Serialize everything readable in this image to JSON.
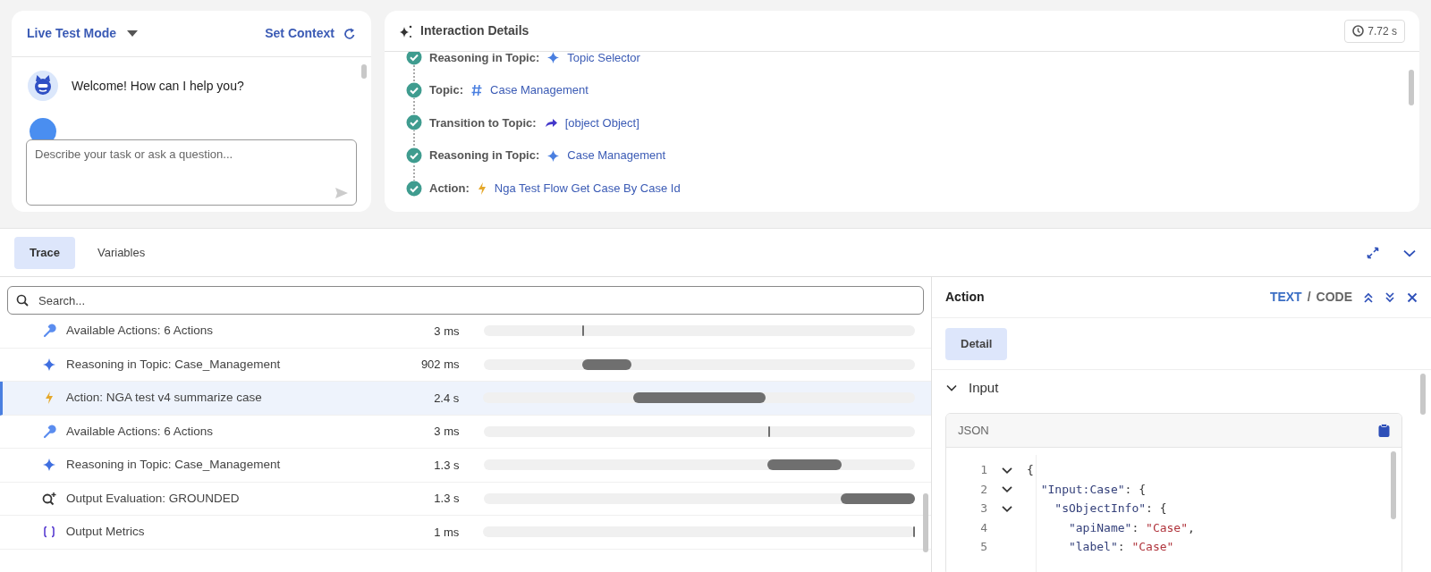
{
  "chat": {
    "mode": "Live Test Mode",
    "set_context": "Set Context",
    "messages": [
      {
        "text": "Welcome! How can I help you?"
      }
    ],
    "input": {
      "placeholder": "Describe your task or ask a question..."
    }
  },
  "interaction": {
    "title": "Interaction Details",
    "duration": "7.72 s",
    "steps": [
      {
        "kind": "reasoning",
        "label": "Reasoning in Topic:",
        "value": "Topic Selector"
      },
      {
        "kind": "topic",
        "label": "Topic:",
        "value": "Case Management"
      },
      {
        "kind": "transition",
        "label": "Transition to Topic:",
        "value": "[object Object]"
      },
      {
        "kind": "reasoning",
        "label": "Reasoning in Topic:",
        "value": "Case Management"
      },
      {
        "kind": "action",
        "label": "Action:",
        "value": "Nga Test Flow Get Case By Case Id"
      }
    ]
  },
  "tabs": [
    {
      "label": "Trace",
      "selected": true
    },
    {
      "label": "Variables",
      "selected": false
    }
  ],
  "trace": {
    "search": {
      "placeholder": "Search..."
    },
    "rows": [
      {
        "kind": "actions",
        "label": "Available Actions: 6 Actions",
        "duration": "3 ms",
        "selected": false
      },
      {
        "kind": "reasoning",
        "label": "Reasoning in Topic: Case_Management",
        "duration": "902 ms",
        "selected": false
      },
      {
        "kind": "action",
        "label": "Action: NGA test v4 summarize case",
        "duration": "2.4 s",
        "selected": true
      },
      {
        "kind": "actions",
        "label": "Available Actions: 6 Actions",
        "duration": "3 ms",
        "selected": false
      },
      {
        "kind": "reasoning",
        "label": "Reasoning in Topic: Case_Management",
        "duration": "1.3 s",
        "selected": false
      },
      {
        "kind": "evaluation",
        "label": "Output Evaluation: GROUNDED",
        "duration": "1.3 s",
        "selected": false
      },
      {
        "kind": "metrics",
        "label": "Output Metrics",
        "duration": "1 ms",
        "selected": false
      }
    ]
  },
  "detail": {
    "title": "Action",
    "modes": [
      {
        "label": "TEXT",
        "selected": true
      },
      {
        "label": "CODE",
        "selected": false
      }
    ],
    "separator": "/",
    "tabs": [
      {
        "label": "Detail",
        "selected": true
      }
    ],
    "section": {
      "title": "Input",
      "expanded": true,
      "format": "JSON",
      "lines": [
        {
          "number": "1",
          "fold": true,
          "parts": [
            {
              "kind": "plain",
              "text": "{"
            }
          ]
        },
        {
          "number": "2",
          "fold": true,
          "parts": [
            {
              "kind": "key",
              "text": "  \"Input:Case\""
            },
            {
              "kind": "plain",
              "text": ": {"
            }
          ]
        },
        {
          "number": "3",
          "fold": true,
          "parts": [
            {
              "kind": "key",
              "text": "    \"sObjectInfo\""
            },
            {
              "kind": "plain",
              "text": ": {"
            }
          ]
        },
        {
          "number": "4",
          "fold": false,
          "parts": [
            {
              "kind": "key",
              "text": "      \"apiName\""
            },
            {
              "kind": "plain",
              "text": ": "
            },
            {
              "kind": "string",
              "text": "\"Case\""
            },
            {
              "kind": "plain",
              "text": ","
            }
          ]
        },
        {
          "number": "5",
          "fold": false,
          "parts": [
            {
              "kind": "key",
              "text": "      \"label\""
            },
            {
              "kind": "plain",
              "text": ": "
            },
            {
              "kind": "string",
              "text": "\"Case\""
            }
          ]
        }
      ]
    }
  }
}
